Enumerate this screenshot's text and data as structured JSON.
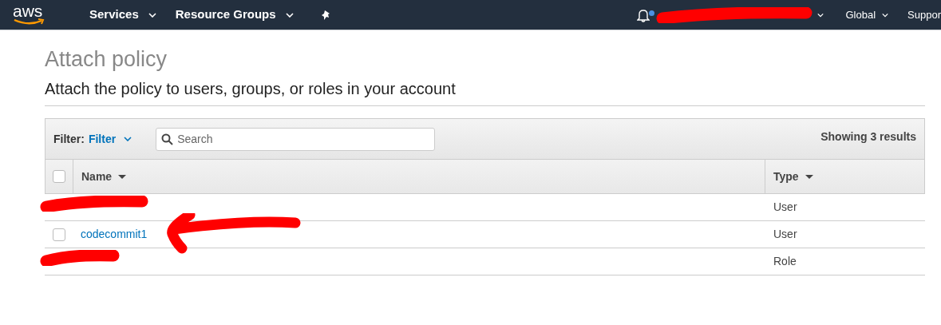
{
  "navbar": {
    "logo": "aws",
    "menus": [
      {
        "label": "Services"
      },
      {
        "label": "Resource Groups"
      }
    ],
    "notification_dot": true,
    "account": {
      "redacted": true
    },
    "region": "Global",
    "support": "Suppor"
  },
  "page": {
    "title": "Attach policy",
    "subtitle": "Attach the policy to users, groups, or roles in your account"
  },
  "table": {
    "filter_label": "Filter:",
    "filter_value": "Filter",
    "search": {
      "placeholder": "Search"
    },
    "result_count": "Showing 3 results",
    "select_all": {
      "checked": false
    },
    "columns": [
      {
        "label": "Name"
      },
      {
        "label": "Type"
      }
    ],
    "rows": [
      {
        "redacted": true,
        "type": "User"
      },
      {
        "redacted": false,
        "checked": false,
        "name": "codecommit1",
        "type": "User",
        "arrow": true
      },
      {
        "redacted": true,
        "type": "Role"
      }
    ]
  }
}
